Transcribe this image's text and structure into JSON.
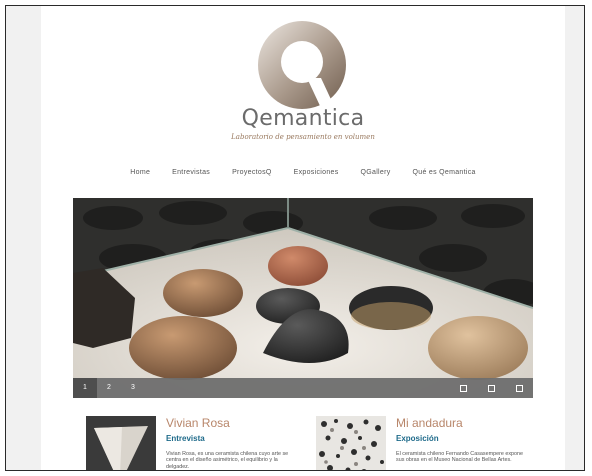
{
  "brand": {
    "name": "Qemantica",
    "tagline": "Laboratorio de pensamiento en volumen",
    "gradient_start": "#e9e3dd",
    "gradient_end": "#7d6a5b"
  },
  "nav": {
    "items": [
      {
        "label": "Home"
      },
      {
        "label": "Entrevistas"
      },
      {
        "label": "ProyectosQ"
      },
      {
        "label": "Exposiciones"
      },
      {
        "label": "QGallery"
      },
      {
        "label": "Qué es Qemantica"
      }
    ]
  },
  "slider": {
    "pages": [
      "1",
      "2",
      "3"
    ],
    "active_page": "1",
    "controls": [
      "prev",
      "pause",
      "next"
    ]
  },
  "cards": [
    {
      "title": "Vivian Rosa",
      "subtitle": "Entrevista",
      "description": "Vivian Rosa, es una ceramista chilena cuyo arte se centra en el diseño asimétrico, el equilibrio y la delgadez."
    },
    {
      "title": "Mi andadura",
      "subtitle": "Exposición",
      "description": "El ceramista chileno Fernando Casasempere expone sus obras en el Museo Nacional de Bellas Artes."
    }
  ]
}
